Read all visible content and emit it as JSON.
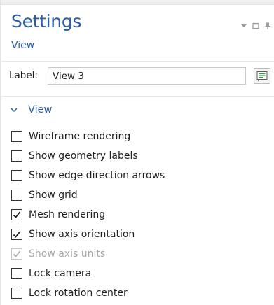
{
  "panel": {
    "title": "Settings",
    "subtitle": "View",
    "controls": {
      "menu_icon": "dropdown-arrow-icon",
      "maximize_icon": "maximize-icon",
      "pin_icon": "pin-icon"
    }
  },
  "label_field": {
    "label": "Label:",
    "value": "View 3",
    "button_icon": "label-edit-icon"
  },
  "section": {
    "title": "View",
    "expanded": true,
    "options": [
      {
        "label": "Wireframe rendering",
        "checked": false,
        "enabled": true
      },
      {
        "label": "Show geometry labels",
        "checked": false,
        "enabled": true
      },
      {
        "label": "Show edge direction arrows",
        "checked": false,
        "enabled": true
      },
      {
        "label": "Show grid",
        "checked": false,
        "enabled": true
      },
      {
        "label": "Mesh rendering",
        "checked": true,
        "enabled": true
      },
      {
        "label": "Show axis orientation",
        "checked": true,
        "enabled": true
      },
      {
        "label": "Show axis units",
        "checked": true,
        "enabled": false
      },
      {
        "label": "Lock camera",
        "checked": false,
        "enabled": true
      },
      {
        "label": "Lock rotation center",
        "checked": false,
        "enabled": true
      }
    ]
  },
  "colors": {
    "accent": "#2b5ca8",
    "disabled_text": "#a8a8a8",
    "check": "#1a1a1a",
    "check_disabled": "#b0b0b0"
  }
}
